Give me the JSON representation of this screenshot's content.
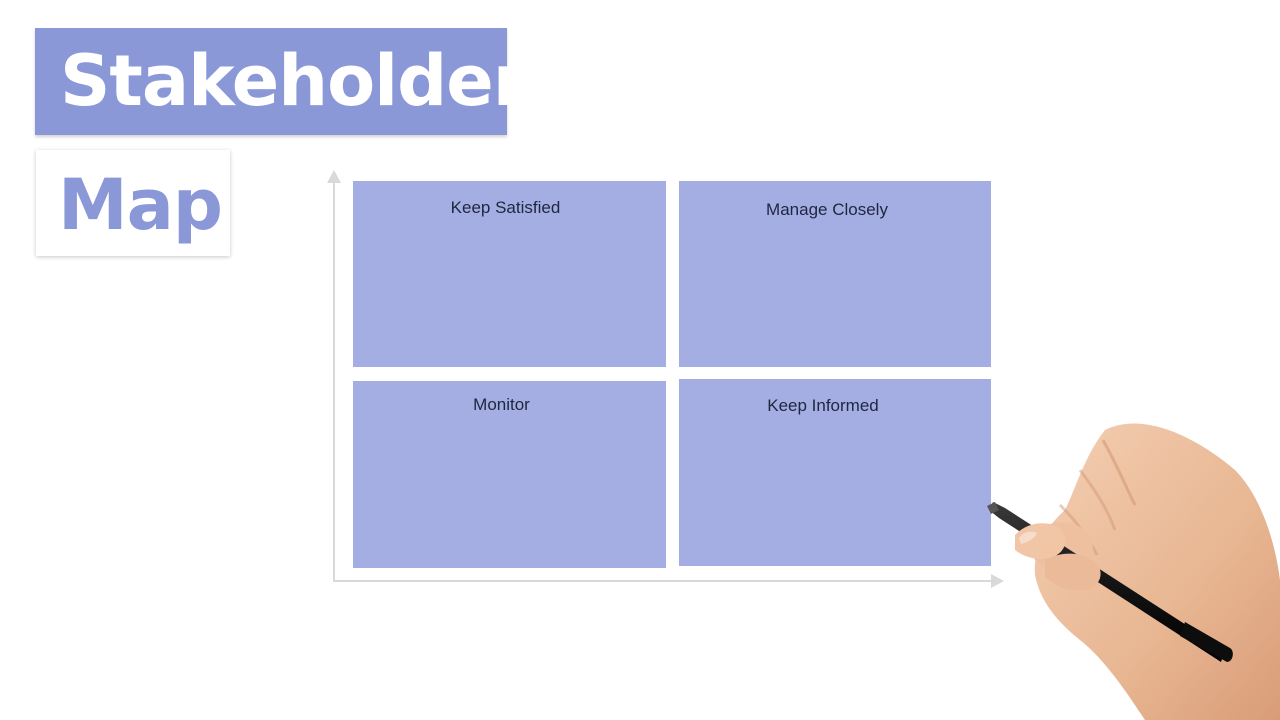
{
  "title": {
    "line1": "Stakeholder",
    "line2": "Map"
  },
  "quadrants": {
    "top_left": "Keep Satisfied",
    "top_right": "Manage Closely",
    "bottom_left": "Monitor",
    "bottom_right": "Keep Informed"
  },
  "colors": {
    "title_bg": "#8a98d8",
    "quadrant_fill": "#a5aee2",
    "axis": "#d9d9d9",
    "label_text": "#1f2640"
  },
  "icons": {
    "hand": "hand-with-marker-icon"
  }
}
